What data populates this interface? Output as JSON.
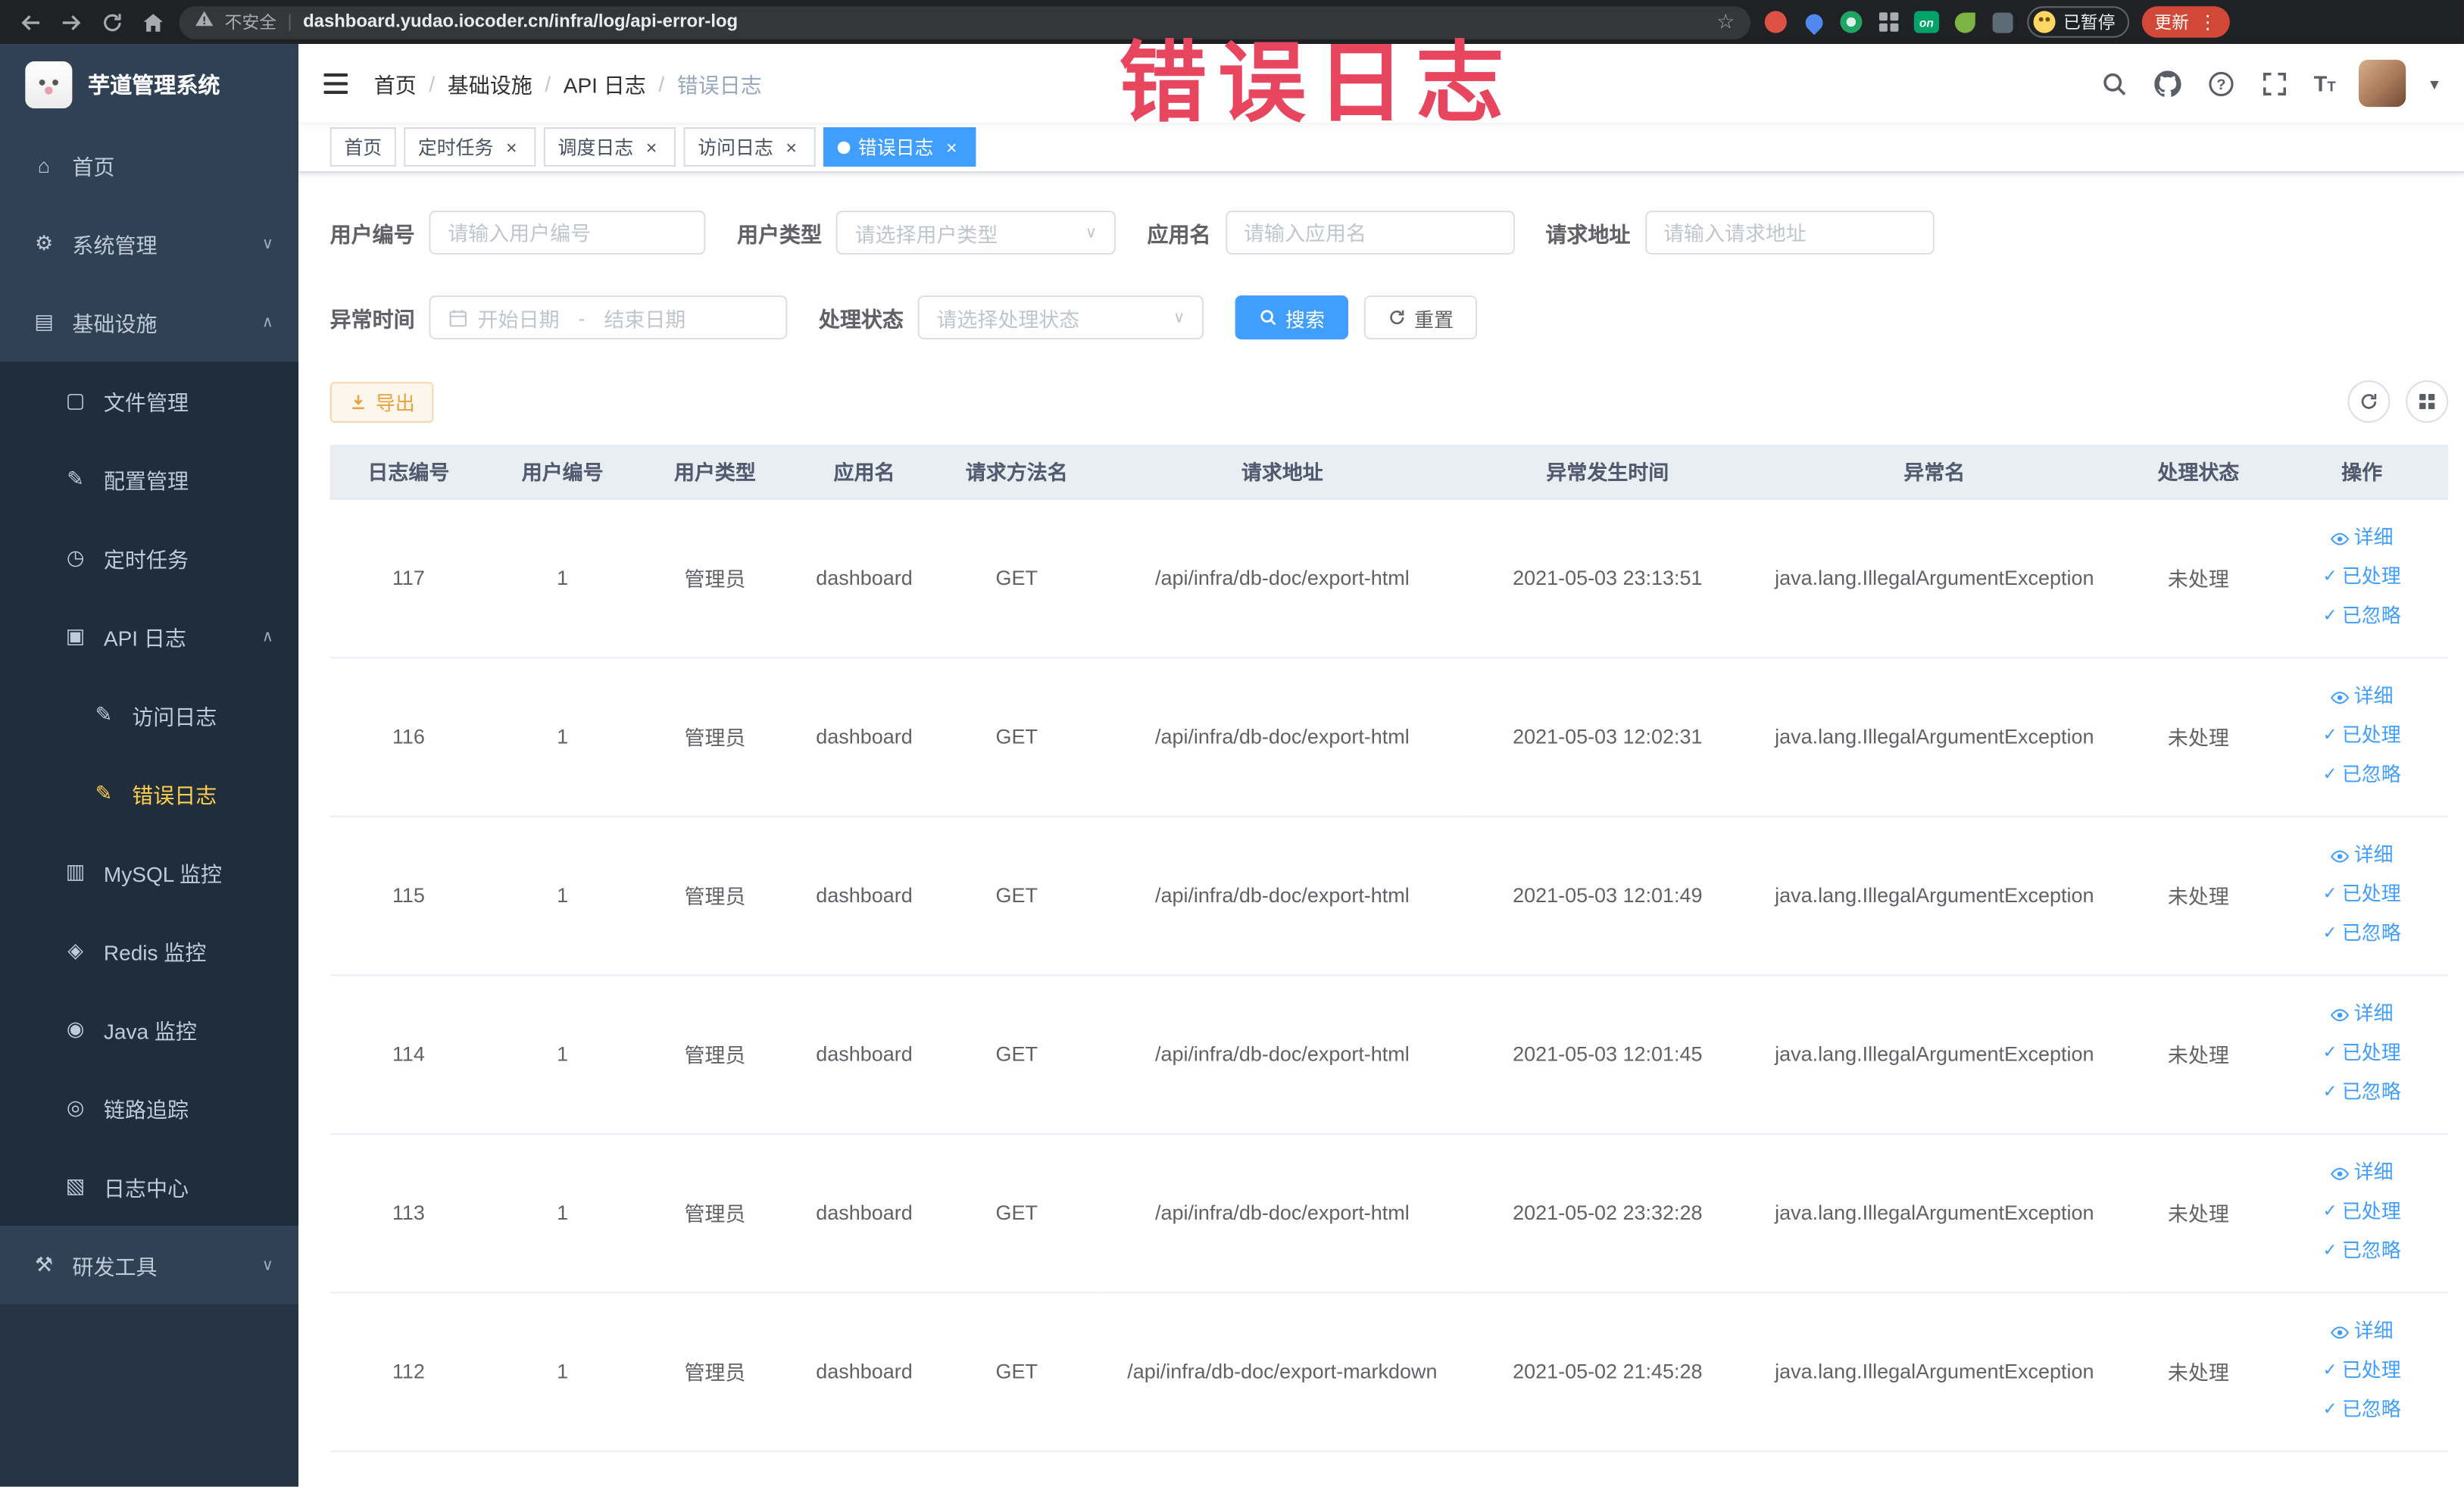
{
  "annotation": {
    "text": "错误日志",
    "color": "#e8455f"
  },
  "browser": {
    "security_label": "不安全",
    "separator": "|",
    "url": "dashboard.yudao.iocoder.cn/infra/log/api-error-log",
    "on_badge": "on",
    "paused_badge": "已暂停",
    "update_button": "更新"
  },
  "sidebar": {
    "title": "芋道管理系统",
    "items": [
      {
        "name": "home",
        "label": "首页",
        "icon": "home",
        "level": 0
      },
      {
        "name": "system-management",
        "label": "系统管理",
        "icon": "gear",
        "level": 0,
        "arrow": "down"
      },
      {
        "name": "infrastructure",
        "label": "基础设施",
        "icon": "tree",
        "level": 0,
        "arrow": "up"
      },
      {
        "name": "file-management",
        "label": "文件管理",
        "icon": "file",
        "level": 1
      },
      {
        "name": "config-management",
        "label": "配置管理",
        "icon": "edit",
        "level": 1
      },
      {
        "name": "scheduled-job",
        "label": "定时任务",
        "icon": "clock",
        "level": 1
      },
      {
        "name": "api-log",
        "label": "API 日志",
        "icon": "log",
        "level": 1,
        "arrow": "up"
      },
      {
        "name": "access-log",
        "label": "访问日志",
        "icon": "doc",
        "level": 2
      },
      {
        "name": "error-log",
        "label": "错误日志",
        "icon": "doc",
        "level": 2,
        "active": true
      },
      {
        "name": "mysql-monitor",
        "label": "MySQL 监控",
        "icon": "db",
        "level": 1
      },
      {
        "name": "redis-monitor",
        "label": "Redis 监控",
        "icon": "redis",
        "level": 1
      },
      {
        "name": "java-monitor",
        "label": "Java 监控",
        "icon": "java",
        "level": 1
      },
      {
        "name": "trace",
        "label": "链路追踪",
        "icon": "eye",
        "level": 1
      },
      {
        "name": "log-center",
        "label": "日志中心",
        "icon": "center",
        "level": 1
      },
      {
        "name": "dev-tools",
        "label": "研发工具",
        "icon": "tools",
        "level": 0,
        "arrow": "down"
      }
    ]
  },
  "header": {
    "breadcrumb": [
      "首页",
      "基础设施",
      "API 日志",
      "错误日志"
    ],
    "breadcrumb_separator": "/"
  },
  "tabs": [
    {
      "name": "home",
      "label": "首页",
      "closable": false,
      "active": false
    },
    {
      "name": "job",
      "label": "定时任务",
      "closable": true,
      "active": false
    },
    {
      "name": "job-log",
      "label": "调度日志",
      "closable": true,
      "active": false
    },
    {
      "name": "access-log",
      "label": "访问日志",
      "closable": true,
      "active": false
    },
    {
      "name": "error-log",
      "label": "错误日志",
      "closable": true,
      "active": true
    }
  ],
  "filters": {
    "user_id": {
      "label": "用户编号",
      "placeholder": "请输入用户编号"
    },
    "user_type": {
      "label": "用户类型",
      "placeholder": "请选择用户类型"
    },
    "app_name": {
      "label": "应用名",
      "placeholder": "请输入应用名"
    },
    "request_url": {
      "label": "请求地址",
      "placeholder": "请输入请求地址"
    },
    "exception_time": {
      "label": "异常时间",
      "start_placeholder": "开始日期",
      "separator": "-",
      "end_placeholder": "结束日期"
    },
    "process_status": {
      "label": "处理状态",
      "placeholder": "请选择处理状态"
    },
    "search_button": "搜索",
    "reset_button": "重置"
  },
  "toolbar": {
    "export_label": "导出"
  },
  "table": {
    "columns": [
      "日志编号",
      "用户编号",
      "用户类型",
      "应用名",
      "请求方法名",
      "请求地址",
      "异常发生时间",
      "异常名",
      "处理状态",
      "操作"
    ],
    "row_actions": [
      "详细",
      "已处理",
      "已忽略"
    ],
    "rows": [
      {
        "id": "117",
        "user_id": "1",
        "user_type": "管理员",
        "app": "dashboard",
        "method": "GET",
        "url": "/api/infra/db-doc/export-html",
        "time": "2021-05-03 23:13:51",
        "exception": "java.lang.IllegalArgumentException",
        "status": "未处理"
      },
      {
        "id": "116",
        "user_id": "1",
        "user_type": "管理员",
        "app": "dashboard",
        "method": "GET",
        "url": "/api/infra/db-doc/export-html",
        "time": "2021-05-03 12:02:31",
        "exception": "java.lang.IllegalArgumentException",
        "status": "未处理"
      },
      {
        "id": "115",
        "user_id": "1",
        "user_type": "管理员",
        "app": "dashboard",
        "method": "GET",
        "url": "/api/infra/db-doc/export-html",
        "time": "2021-05-03 12:01:49",
        "exception": "java.lang.IllegalArgumentException",
        "status": "未处理"
      },
      {
        "id": "114",
        "user_id": "1",
        "user_type": "管理员",
        "app": "dashboard",
        "method": "GET",
        "url": "/api/infra/db-doc/export-html",
        "time": "2021-05-03 12:01:45",
        "exception": "java.lang.IllegalArgumentException",
        "status": "未处理"
      },
      {
        "id": "113",
        "user_id": "1",
        "user_type": "管理员",
        "app": "dashboard",
        "method": "GET",
        "url": "/api/infra/db-doc/export-html",
        "time": "2021-05-02 23:32:28",
        "exception": "java.lang.IllegalArgumentException",
        "status": "未处理"
      },
      {
        "id": "112",
        "user_id": "1",
        "user_type": "管理员",
        "app": "dashboard",
        "method": "GET",
        "url": "/api/infra/db-doc/export-markdown",
        "time": "2021-05-02 21:45:28",
        "exception": "java.lang.IllegalArgumentException",
        "status": "未处理"
      }
    ]
  },
  "colors": {
    "accent": "#409eff",
    "menu_active": "#ffd04b",
    "warning": "#e6a23c",
    "annotation": "#e8455f"
  }
}
